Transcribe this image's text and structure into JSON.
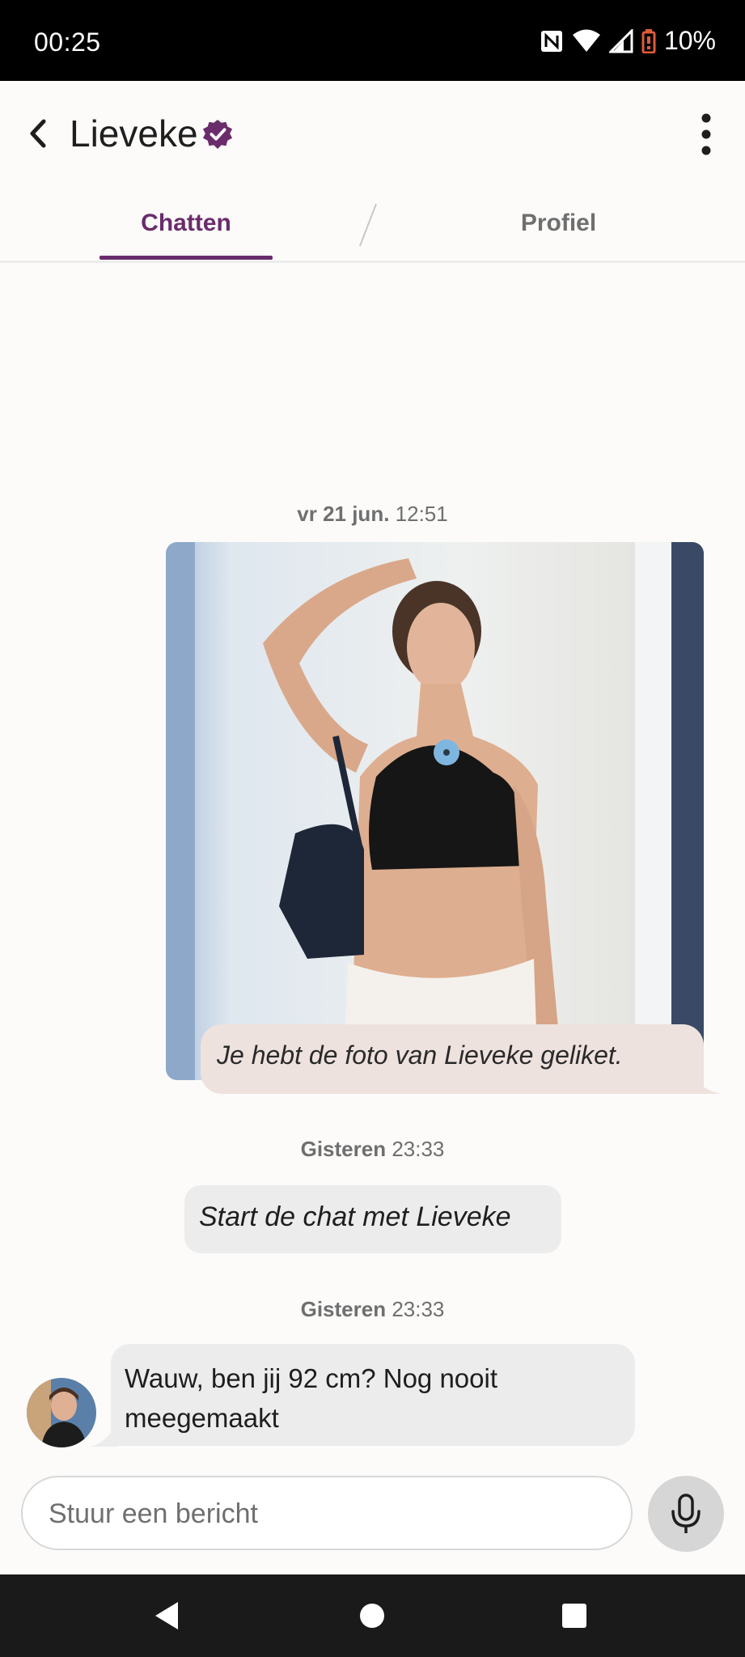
{
  "status_bar": {
    "time": "00:25",
    "battery": "10%",
    "icons": [
      "nfc-icon",
      "wifi-icon",
      "signal-icon",
      "battery-low-icon"
    ]
  },
  "header": {
    "contact_name": "Lieveke",
    "verified": true
  },
  "tabs": [
    {
      "label": "Chatten",
      "active": true
    },
    {
      "label": "Profiel",
      "active": false
    }
  ],
  "chat": {
    "first_date": {
      "day": "vr 21 jun.",
      "time": "12:51"
    },
    "like_notice": "Je hebt de foto van Lieveke geliket.",
    "second_date": {
      "day": "Gisteren",
      "time": "23:33"
    },
    "start_prompt": "Start de chat met Lieveke",
    "third_date": {
      "day": "Gisteren",
      "time": "23:33"
    },
    "incoming_message": "Wauw, ben jij 92 cm? Nog nooit meegemaakt"
  },
  "composer": {
    "placeholder": "Stuur een bericht"
  },
  "colors": {
    "accent": "#6a2c6b",
    "background": "#fcfbfa",
    "bubble_grey": "#ececec",
    "bubble_pink": "#eee2de"
  }
}
